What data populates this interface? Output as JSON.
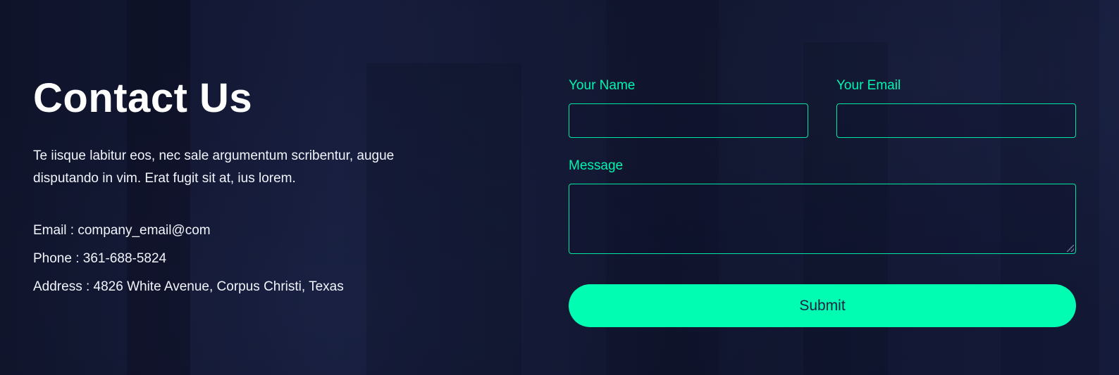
{
  "contact": {
    "title": "Contact Us",
    "description": "Te iisque labitur eos, nec sale argumentum scribentur, augue disputando in vim. Erat fugit sit at, ius lorem.",
    "email": "Email : company_email@com",
    "phone": "Phone : 361-688-5824",
    "address": "Address : 4826 White Avenue, Corpus Christi, Texas"
  },
  "form": {
    "name_label": "Your Name",
    "name_value": "",
    "email_label": "Your Email",
    "email_value": "",
    "message_label": "Message",
    "message_value": "",
    "submit_label": "Submit"
  },
  "colors": {
    "background": "#161c3a",
    "accent": "#00fdb2",
    "label": "#00f5b0",
    "text": "#ffffff",
    "button_text": "#1a2140"
  }
}
